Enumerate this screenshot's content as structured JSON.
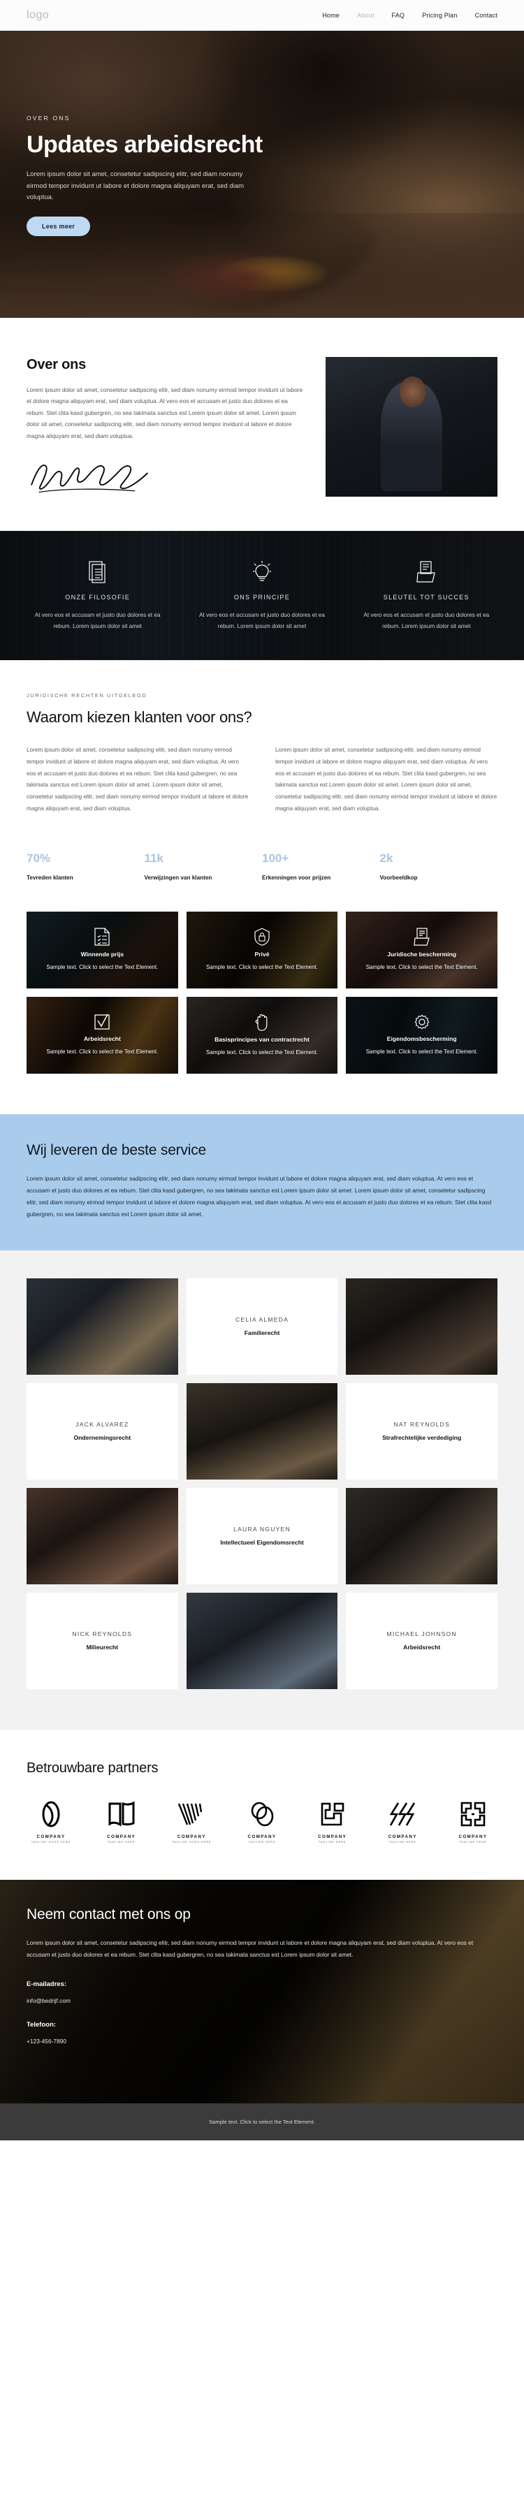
{
  "header": {
    "logo": "logo",
    "nav": [
      {
        "label": "Home",
        "active": false
      },
      {
        "label": "About",
        "active": true
      },
      {
        "label": "FAQ",
        "active": false
      },
      {
        "label": "Pricing Plan",
        "active": false
      },
      {
        "label": "Contact",
        "active": false
      }
    ]
  },
  "hero": {
    "eyebrow": "OVER ONS",
    "title": "Updates arbeidsrecht",
    "subtitle": "Lorem ipsum dolor sit amet, consetetur sadipscing elitr, sed diam nonumy eirmod tempor invidunt ut labore et dolore magna aliquyam erat, sed diam voluptua.",
    "button": "Lees meer",
    "button_color": "#bfd9f2"
  },
  "about": {
    "title": "Over ons",
    "paragraph": "Lorem ipsum dolor sit amet, consetetur sadipscing elitr, sed diam nonumy eirmod tempor invidunt ut labore et dolore magna aliquyam erat, sed diam voluptua. At vero eos et accusam et justo duo dolores et ea rebum. Stet clita kasd gubergren, no sea takimata sanctus est Lorem ipsum dolor sit amet. Lorem ipsum dolor sit amet, consetetur sadipscing elitr, sed diam nonumy eirmod tempor invidunt ut labore et dolore magna aliquyam erat, sed diam voluptua.",
    "signature_alt": "signature",
    "photo_alt": "portrait-of-lawyer"
  },
  "features": [
    {
      "icon": "document-icon",
      "title": "ONZE FILOSOFIE",
      "text": "At vero eos et accusam et justo duo dolores et ea rebum. Lorem ipsum dolor sit amet"
    },
    {
      "icon": "lightbulb-icon",
      "title": "ONS PRINCIPE",
      "text": "At vero eos et accusam et justo duo dolores et ea rebum. Lorem ipsum dolor sit amet"
    },
    {
      "icon": "folder-icon",
      "title": "SLEUTEL TOT SUCCES",
      "text": "At vero eos et accusam et justo duo dolores et ea rebum. Lorem ipsum dolor sit amet"
    }
  ],
  "why": {
    "eyebrow": "JURIDISCHE RECHTEN UITGELEGD",
    "title": "Waarom kiezen klanten voor ons?",
    "column_left": "Lorem ipsum dolor sit amet, consetetur sadipscing elitr, sed diam nonumy eirmod tempor invidunt ut labore et dolore magna aliquyam erat, sed diam voluptua. At vero eos et accusam et justo duo dolores et ea rebum. Stet clita kasd gubergren, no sea takimata sanctus est Lorem ipsum dolor sit amet. Lorem ipsum dolor sit amet, consetetur sadipscing elitr, sed diam nonumy eirmod tempor invidunt ut labore et dolore magna aliquyam erat, sed diam voluptua.",
    "column_right": "Lorem ipsum dolor sit amet, consetetur sadipscing elitr, sed diam nonumy eirmod tempor invidunt ut labore et dolore magna aliquyam erat, sed diam voluptua. At vero eos et accusam et justo duo dolores et ea rebum. Stet clita kasd gubergren, no sea takimata sanctus est Lorem ipsum dolor sit amet. Lorem ipsum dolor sit amet, consetetur sadipscing elitr, sed diam nonumy eirmod tempor invidunt ut labore et dolore magna aliquyam erat, sed diam voluptua."
  },
  "stats": [
    {
      "number": "70%",
      "label": "Tevreden klanten"
    },
    {
      "number": "11k",
      "label": "Verwijzingen van klanten"
    },
    {
      "number": "100+",
      "label": "Erkenningen voor prijzen"
    },
    {
      "number": "2k",
      "label": "Voorbeeldkop"
    }
  ],
  "stats_accent_color": "#a9c5e2",
  "cards": [
    {
      "icon": "checklist-document-icon",
      "title": "Winnende prijs",
      "text": "Sample text. Click to select the Text Element."
    },
    {
      "icon": "secure-lock-icon",
      "title": "Privé",
      "text": "Sample text. Click to select the Text Element."
    },
    {
      "icon": "book-shield-icon",
      "title": "Juridische bescherming",
      "text": "Sample text. Click to select the Text Element."
    },
    {
      "icon": "checkbox-icon",
      "title": "Arbeidsrecht",
      "text": "Sample text. Click to select the Text Element."
    },
    {
      "icon": "hand-icon",
      "title": "Basisprincipes van contractrecht",
      "text": "Sample text. Click to select the Text Element."
    },
    {
      "icon": "gear-icon",
      "title": "Eigendomsbescherming",
      "text": "Sample text. Click to select the Text Element."
    }
  ],
  "service": {
    "title": "Wij leveren de beste service",
    "background_color": "#a9cced",
    "text": "Lorem ipsum dolor sit amet, consetetur sadipscing elitr, sed diam nonumy eirmod tempor invidunt ut labore et dolore magna aliquyam erat, sed diam voluptua. At vero eos et accusam et justo duo dolores et ea rebum. Stet clita kasd gubergren, no sea takimata sanctus est Lorem ipsum dolor sit amet. Lorem ipsum dolor sit amet, consetetur sadipscing elitr, sed diam nonumy eirmod tempor invidunt ut labore et dolore magna aliquyam erat, sed diam voluptua. At vero eos et accusam et justo duo dolores et ea rebum. Stet clita kasd gubergren, no sea takimata sanctus est Lorem ipsum dolor sit amet."
  },
  "team": [
    {
      "type": "photo"
    },
    {
      "type": "card",
      "name": "CELIA ALMEDA",
      "role": "Familierecht"
    },
    {
      "type": "photo"
    },
    {
      "type": "card",
      "name": "JACK ALVAREZ",
      "role": "Ondernemingsrecht"
    },
    {
      "type": "photo"
    },
    {
      "type": "card",
      "name": "NAT REYNOLDS",
      "role": "Strafrechtelijke verdediging"
    },
    {
      "type": "photo"
    },
    {
      "type": "card",
      "name": "LAURA NGUYEN",
      "role": "Intellectueel Eigendomsrecht"
    },
    {
      "type": "photo"
    },
    {
      "type": "card",
      "name": "NICK REYNOLDS",
      "role": "Milieurecht"
    },
    {
      "type": "photo"
    },
    {
      "type": "card",
      "name": "MICHAEL JOHNSON",
      "role": "Arbeidsrecht"
    }
  ],
  "partners": {
    "title": "Betrouwbare partners",
    "items": [
      {
        "mark": "oval-outline-logo",
        "name": "COMPANY",
        "tagline": "TAGLINE GOES HERE"
      },
      {
        "mark": "open-book-logo",
        "name": "COMPANY",
        "tagline": "TAGLINE HERE"
      },
      {
        "mark": "striped-v-logo",
        "name": "COMPANY",
        "tagline": "TAGLINE GOES HERE"
      },
      {
        "mark": "double-circle-logo",
        "name": "COMPANY",
        "tagline": "TAGLINE HERE"
      },
      {
        "mark": "square-bracket-logo",
        "name": "COMPANY",
        "tagline": "TAGLINE HERE"
      },
      {
        "mark": "diagonal-stripes-logo",
        "name": "COMPANY",
        "tagline": "TAGLINE HERE"
      },
      {
        "mark": "interlock-square-logo",
        "name": "COMPANY",
        "tagline": "TAGLINE HERE"
      }
    ]
  },
  "contact": {
    "title": "Neem contact met ons op",
    "text": "Lorem ipsum dolor sit amet, consetetur sadipscing elitr, sed diam nonumy eirmod tempor invidunt ut labore et dolore magna aliquyam erat, sed diam voluptua. At vero eos et accusam et justo duo dolores et ea rebum. Stet clita kasd gubergren, no sea takimata sanctus est Lorem ipsum dolor sit amet.",
    "email_label": "E-mailadres:",
    "email_value": "info@bedrijf.com",
    "phone_label": "Telefoon:",
    "phone_value": "+123-456-7890"
  },
  "footer": {
    "text": "Sample text. Click to select the Text Element."
  }
}
